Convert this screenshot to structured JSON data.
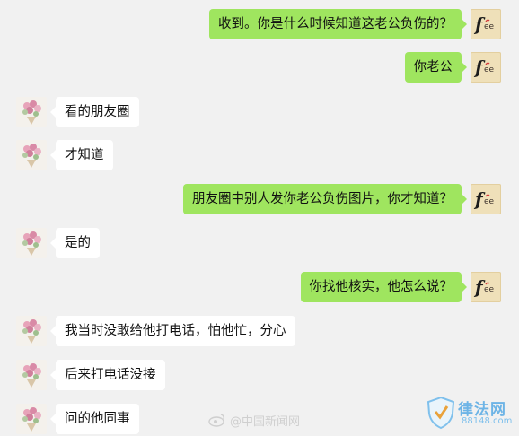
{
  "messages": [
    {
      "side": "right",
      "text": "收到。你是什么时候知道这老公负伤的？"
    },
    {
      "side": "right",
      "text": "你老公"
    },
    {
      "side": "left",
      "text": "看的朋友圈"
    },
    {
      "side": "left",
      "text": "才知道"
    },
    {
      "side": "right",
      "text": "朋友圈中别人发你老公负伤图片，你才知道？"
    },
    {
      "side": "left",
      "text": "是的"
    },
    {
      "side": "right",
      "text": "你找他核实，他怎么说？"
    },
    {
      "side": "left",
      "text": "我当时没敢给他打电话，怕他忙，分心"
    },
    {
      "side": "left",
      "text": "后来打电话没接"
    },
    {
      "side": "left",
      "text": "问的他同事"
    }
  ],
  "avatars": {
    "me": {
      "icon": "fee-logo-avatar",
      "text": "fee"
    },
    "other": {
      "icon": "flower-bouquet-avatar"
    }
  },
  "watermarks": {
    "weibo": "@中国新闻网",
    "logo_main": "律法网",
    "logo_sub": "88148.com"
  },
  "colors": {
    "background": "#f1f1f1",
    "bubble_me": "#9fe55f",
    "bubble_other": "#ffffff"
  }
}
